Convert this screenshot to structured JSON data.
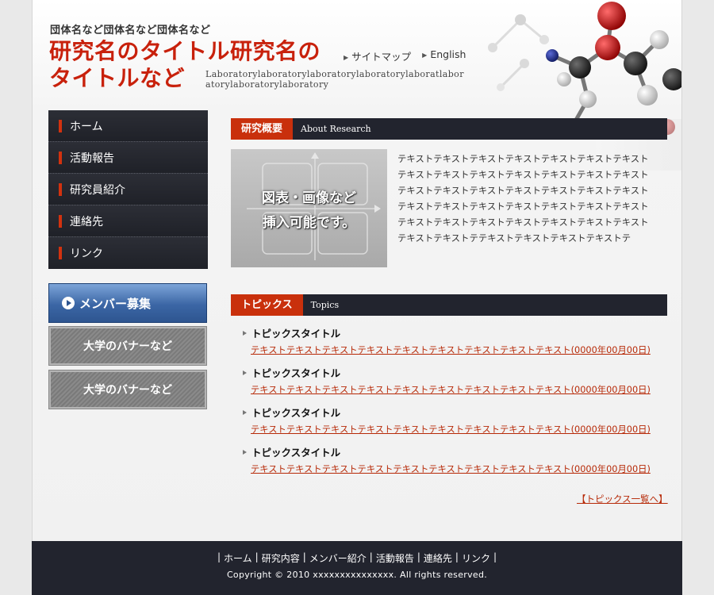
{
  "header": {
    "org_name": "団体名など団体名など団体名など",
    "title_line1": "研究名のタイトル研究名の",
    "title_line2": "タイトルなど",
    "links": {
      "sitemap": "サイトマップ",
      "english": "English"
    },
    "lab_text": "Laboratorylaboratorylaboratorylaboratorylaboratlaboratorylaboratorylaboratory"
  },
  "nav": {
    "items": [
      {
        "label": "ホーム"
      },
      {
        "label": "活動報告"
      },
      {
        "label": "研究員紹介"
      },
      {
        "label": "連絡先"
      },
      {
        "label": "リンク"
      }
    ]
  },
  "banners": {
    "member": "メンバー募集",
    "univ1": "大学のバナーなど",
    "univ2": "大学のバナーなど"
  },
  "about": {
    "heading_jp": "研究概要",
    "heading_en": "About Research",
    "figure_line1": "図表・画像など",
    "figure_line2": "挿入可能です。",
    "text": "テキストテキストテキストテキストテキストテキストテキストテキストテキストテキストテキストテキストテキストテキストテキストテキストテキストテキストテキストテキストテキストテキストテキストテキストテキストテキストテキストテキストテキストテキストテキストテキストテキストテキストテキストテキストテキストテテキストテキストテキストテキストテ"
  },
  "topics": {
    "heading_jp": "トピックス",
    "heading_en": "Topics",
    "items": [
      {
        "title": "トピックスタイトル",
        "link": "テキストテキストテキストテキストテキストテキストテキストテキストテキスト(0000年00月00日)"
      },
      {
        "title": "トピックスタイトル",
        "link": "テキストテキストテキストテキストテキストテキストテキストテキストテキスト(0000年00月00日)"
      },
      {
        "title": "トピックスタイトル",
        "link": "テキストテキストテキストテキストテキストテキストテキストテキストテキスト(0000年00月00日)"
      },
      {
        "title": "トピックスタイトル",
        "link": "テキストテキストテキストテキストテキストテキストテキストテキストテキスト(0000年00月00日)"
      }
    ],
    "more": "【トピックス一覧へ】"
  },
  "footer": {
    "nav": [
      "ホーム",
      "研究内容",
      "メンバー紹介",
      "活動報告",
      "連絡先",
      "リンク"
    ],
    "separator": "|",
    "copyright": "Copyright © 2010 xxxxxxxxxxxxxxx. All rights reserved."
  },
  "colors": {
    "accent": "#c9300c",
    "dark": "#22242e",
    "link": "#b72a08"
  },
  "icons": [
    "play-icon",
    "arrow-icon",
    "molecule-image"
  ]
}
